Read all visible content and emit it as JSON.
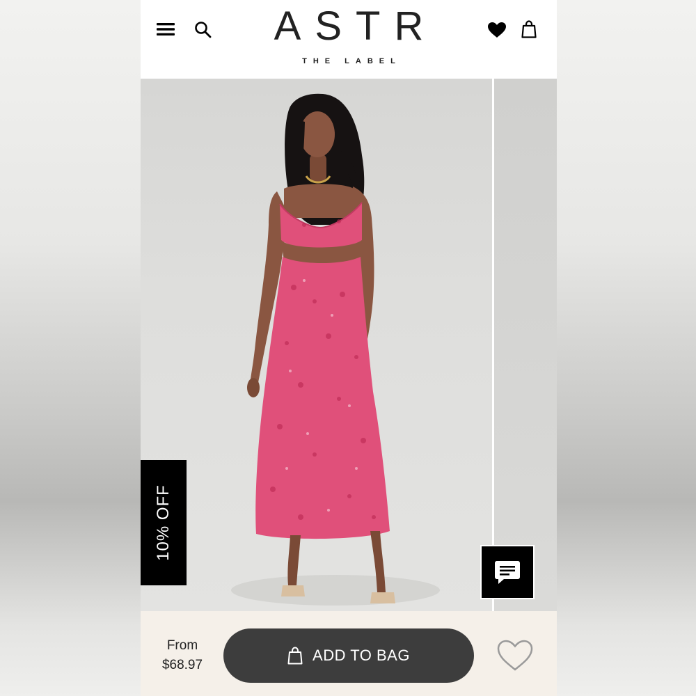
{
  "header": {
    "logo": "ASTR",
    "tagline": "THE LABEL",
    "icons": {
      "menu": "hamburger-menu-icon",
      "search": "search-icon",
      "wishlist": "heart-filled-icon",
      "bag": "shopping-bag-icon"
    }
  },
  "product": {
    "badge": "10% OFF",
    "price_label": "From",
    "price": "$68.97",
    "add_to_bag": "ADD TO BAG",
    "dress_color": "#e0507a"
  },
  "chat": {
    "icon": "chat-message-icon"
  },
  "colors": {
    "header_bg": "#ffffff",
    "bottom_bar_bg": "#f5f0e9",
    "button_bg": "#3d3d3d",
    "badge_bg": "#000000"
  }
}
